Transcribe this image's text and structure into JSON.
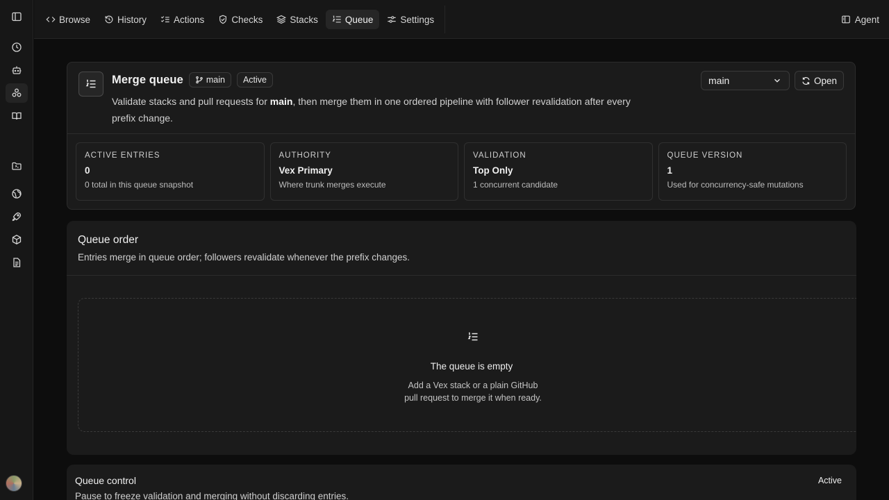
{
  "nav": {
    "tabs": [
      {
        "label": "Browse",
        "icon": "code-icon"
      },
      {
        "label": "History",
        "icon": "history-icon"
      },
      {
        "label": "Actions",
        "icon": "list-checks-icon"
      },
      {
        "label": "Checks",
        "icon": "shield-check-icon"
      },
      {
        "label": "Stacks",
        "icon": "layers-icon"
      },
      {
        "label": "Queue",
        "icon": "list-ordered-icon",
        "active": true
      },
      {
        "label": "Settings",
        "icon": "sliders-icon"
      }
    ],
    "agent_label": "Agent"
  },
  "rail": {
    "items": [
      "sidebar-toggle-icon",
      "clock-icon",
      "bot-icon",
      "workflow-icon",
      "book-icon",
      "folder-icon",
      "globe-icon",
      "rocket-icon",
      "package-icon",
      "file-text-icon"
    ]
  },
  "header": {
    "title": "Merge queue",
    "branch": "main",
    "status": "Active",
    "description_prefix": "Validate stacks and pull requests for ",
    "description_branch": "main",
    "description_suffix": ", then merge them in one ordered pipeline with follower revalidation after every prefix change.",
    "branch_select": "main",
    "open_label": "Open"
  },
  "stats": [
    {
      "label": "ACTIVE ENTRIES",
      "value": "0",
      "sub": "0 total in this queue snapshot"
    },
    {
      "label": "AUTHORITY",
      "value": "Vex Primary",
      "sub": "Where trunk merges execute"
    },
    {
      "label": "VALIDATION",
      "value": "Top Only",
      "sub": "1 concurrent candidate"
    },
    {
      "label": "QUEUE VERSION",
      "value": "1",
      "sub": "Used for concurrency-safe mutations"
    }
  ],
  "queue_order": {
    "title": "Queue order",
    "subtitle": "Entries merge in queue order; followers revalidate whenever the prefix changes.",
    "empty_title": "The queue is empty",
    "empty_desc": "Add a Vex stack or a plain GitHub pull request to merge it when ready."
  },
  "queue_control": {
    "title": "Queue control",
    "subtitle": "Pause to freeze validation and merging without discarding entries.",
    "status": "Active"
  },
  "colors": {
    "background": "#0d0d0d",
    "panel": "#1b1b1b",
    "border": "#2c2c2c",
    "text": "#ededed"
  }
}
